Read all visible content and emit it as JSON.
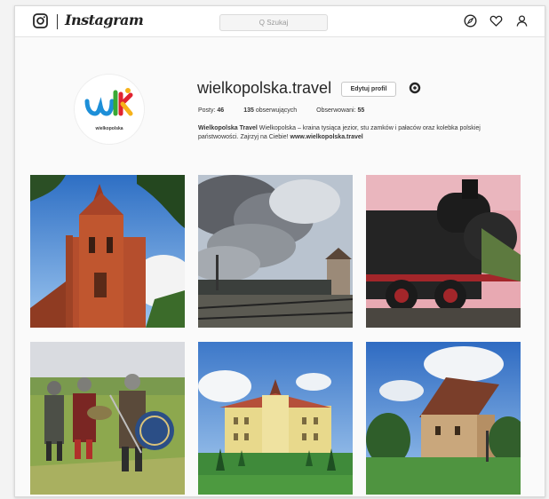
{
  "app": {
    "wordmark": "Instagram",
    "search_placeholder": "Q Szukaj",
    "icons": [
      "instagram-glyph-icon",
      "explore-compass-icon",
      "heart-icon",
      "profile-person-icon"
    ]
  },
  "profile": {
    "username": "wielkopolska.travel",
    "edit_button": "Edytuj profil",
    "avatar_caption": "wielkopolska",
    "stats": {
      "posts_label": "Posty:",
      "posts_value": "46",
      "followers_value": "135",
      "followers_label": "obserwujących",
      "following_label": "Obserwowani:",
      "following_value": "55"
    },
    "bio": {
      "name": "Wielkopolska Travel",
      "text": " Wielkopolska – kraina tysiąca jezior, stu zamków i pałaców oraz kolebka polskiej państwowości. Zajrzyj na Ciebie! ",
      "link": "www.wielkopolska.travel"
    }
  },
  "posts": [
    {
      "subject": "brick church tower"
    },
    {
      "subject": "steam locomotive smoke"
    },
    {
      "subject": "black steam locomotive"
    },
    {
      "subject": "medieval knights reenactment"
    },
    {
      "subject": "baroque palace"
    },
    {
      "subject": "stone castle"
    }
  ],
  "colors": {
    "logo_blue": "#1d8fd8",
    "logo_red": "#e0232f",
    "logo_yellow": "#f6b21a",
    "logo_green": "#39a935"
  }
}
